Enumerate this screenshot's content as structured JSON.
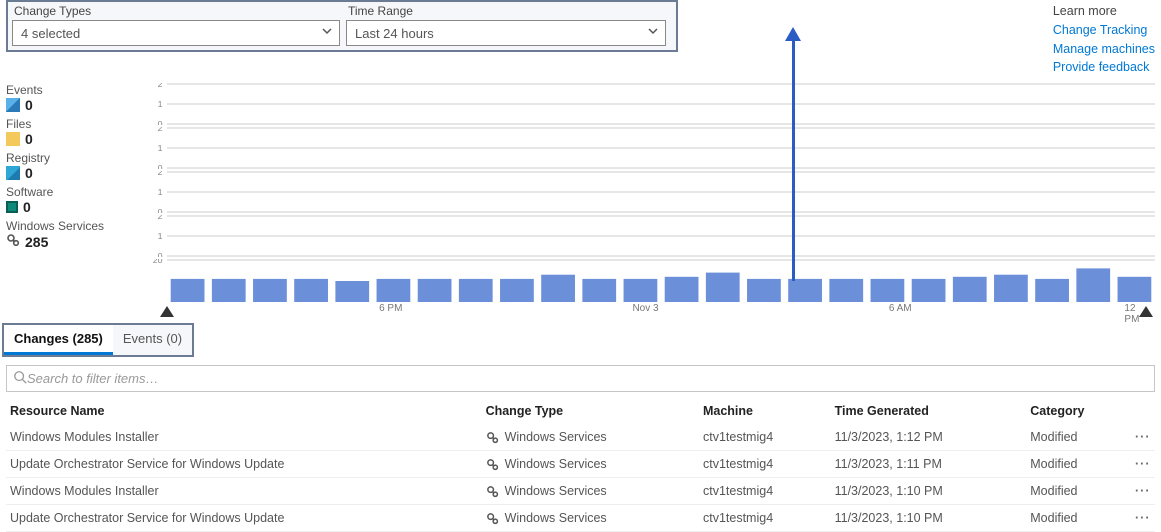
{
  "filters": {
    "changeTypes": {
      "label": "Change Types",
      "value": "4 selected"
    },
    "timeRange": {
      "label": "Time Range",
      "value": "Last 24 hours"
    }
  },
  "learnMore": {
    "title": "Learn more",
    "links": [
      "Change Tracking",
      "Manage machines",
      "Provide feedback"
    ]
  },
  "summary": [
    {
      "key": "events",
      "label": "Events",
      "value": "0"
    },
    {
      "key": "files",
      "label": "Files",
      "value": "0"
    },
    {
      "key": "registry",
      "label": "Registry",
      "value": "0"
    },
    {
      "key": "software",
      "label": "Software",
      "value": "0"
    },
    {
      "key": "services",
      "label": "Windows Services",
      "value": "285"
    }
  ],
  "tabs": {
    "changes": "Changes (285)",
    "events": "Events (0)"
  },
  "search": {
    "placeholder": "Search to filter items…"
  },
  "columns": [
    "Resource Name",
    "Change Type",
    "Machine",
    "Time Generated",
    "Category"
  ],
  "rows": [
    {
      "name": "Windows Modules Installer",
      "ctype": "Windows Services",
      "machine": "ctv1testmig4",
      "time": "11/3/2023, 1:12 PM",
      "cat": "Modified"
    },
    {
      "name": "Update Orchestrator Service for Windows Update",
      "ctype": "Windows Services",
      "machine": "ctv1testmig4",
      "time": "11/3/2023, 1:11 PM",
      "cat": "Modified"
    },
    {
      "name": "Windows Modules Installer",
      "ctype": "Windows Services",
      "machine": "ctv1testmig4",
      "time": "11/3/2023, 1:10 PM",
      "cat": "Modified"
    },
    {
      "name": "Update Orchestrator Service for Windows Update",
      "ctype": "Windows Services",
      "machine": "ctv1testmig4",
      "time": "11/3/2023, 1:10 PM",
      "cat": "Modified"
    }
  ],
  "chart_data": [
    {
      "type": "bar",
      "title": "Events",
      "ylim": [
        0,
        2
      ],
      "ticks": [
        0,
        1,
        2
      ],
      "values": [
        0,
        0,
        0,
        0,
        0,
        0,
        0,
        0,
        0,
        0,
        0,
        0,
        0,
        0,
        0,
        0,
        0,
        0,
        0,
        0,
        0,
        0,
        0,
        0
      ]
    },
    {
      "type": "bar",
      "title": "Files",
      "ylim": [
        0,
        2
      ],
      "ticks": [
        0,
        1,
        2
      ],
      "values": [
        0,
        0,
        0,
        0,
        0,
        0,
        0,
        0,
        0,
        0,
        0,
        0,
        0,
        0,
        0,
        0,
        0,
        0,
        0,
        0,
        0,
        0,
        0,
        0
      ]
    },
    {
      "type": "bar",
      "title": "Registry",
      "ylim": [
        0,
        2
      ],
      "ticks": [
        0,
        1,
        2
      ],
      "values": [
        0,
        0,
        0,
        0,
        0,
        0,
        0,
        0,
        0,
        0,
        0,
        0,
        0,
        0,
        0,
        0,
        0,
        0,
        0,
        0,
        0,
        0,
        0,
        0
      ]
    },
    {
      "type": "bar",
      "title": "Software",
      "ylim": [
        0,
        2
      ],
      "ticks": [
        0,
        1,
        2
      ],
      "values": [
        0,
        0,
        0,
        0,
        0,
        0,
        0,
        0,
        0,
        0,
        0,
        0,
        0,
        0,
        0,
        0,
        0,
        0,
        0,
        0,
        0,
        0,
        0,
        0
      ]
    },
    {
      "type": "bar",
      "title": "Windows Services",
      "ylim": [
        0,
        20
      ],
      "ticks": [
        20
      ],
      "x_ticks": [
        "6 PM",
        "Nov 3",
        "6 AM",
        "12 PM"
      ],
      "values": [
        11,
        11,
        11,
        11,
        10,
        11,
        11,
        11,
        11,
        13,
        11,
        11,
        12,
        14,
        11,
        11,
        11,
        11,
        11,
        12,
        13,
        11,
        16,
        12
      ]
    }
  ],
  "colors": {
    "bar": "#6b8fd9",
    "marker": "#2b5cc4",
    "link": "#0078d4"
  }
}
